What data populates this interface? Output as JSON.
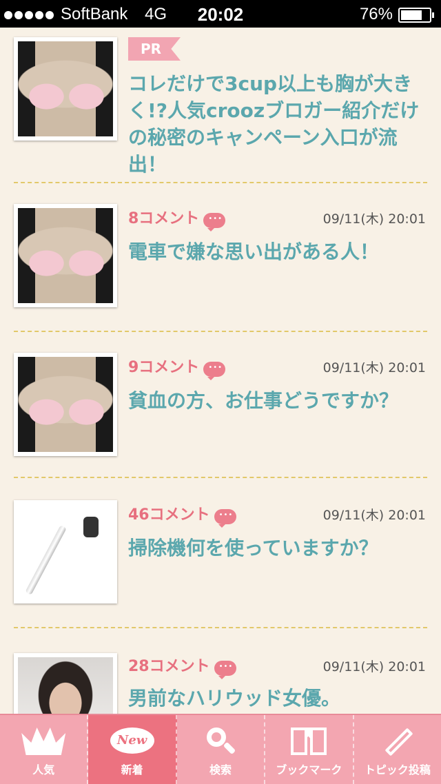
{
  "status_bar": {
    "carrier": "SoftBank",
    "network": "4G",
    "time": "20:02",
    "battery": "76%",
    "battery_level": 0.76
  },
  "feed": {
    "pr_item": {
      "tag": "PR",
      "title": "コレだけで3cup以上も胸が大きく!?人気croozブロガー紹介だけの秘密のキャンペーン入口が流出！",
      "thumb_icon": "photo-bust"
    },
    "items": [
      {
        "comments": "8コメント",
        "date": "09/11(木) 20:01",
        "title": "電車で嫌な思い出がある人！",
        "thumb_icon": "photo-bust"
      },
      {
        "comments": "9コメント",
        "date": "09/11(木) 20:01",
        "title": "貧血の方、お仕事どうですか？",
        "thumb_icon": "photo-bust"
      },
      {
        "comments": "46コメント",
        "date": "09/11(木) 20:01",
        "title": "掃除機何を使っていますか？",
        "thumb_icon": "photo-vacuum-cleaner"
      },
      {
        "comments": "28コメント",
        "date": "09/11(木) 20:01",
        "title": "男前なハリウッド女優。",
        "thumb_icon": "photo-woman"
      }
    ]
  },
  "tab_bar": {
    "tabs": [
      {
        "label": "人気",
        "icon": "crown-icon",
        "active": false
      },
      {
        "label": "新着",
        "icon": "new-bubble-icon",
        "icon_text": "New",
        "active": true
      },
      {
        "label": "検索",
        "icon": "search-icon",
        "active": false
      },
      {
        "label": "ブックマーク",
        "icon": "bookmark-book-icon",
        "active": false
      },
      {
        "label": "トピック投稿",
        "icon": "pencil-icon",
        "active": false
      }
    ]
  },
  "colors": {
    "background": "#f8f1e6",
    "title_teal": "#5ba7ad",
    "comment_pink": "#e7707f",
    "tab_bar_pink": "#f3a6b1",
    "tab_active": "#ec7280",
    "divider_yellow": "#e2c86a"
  }
}
